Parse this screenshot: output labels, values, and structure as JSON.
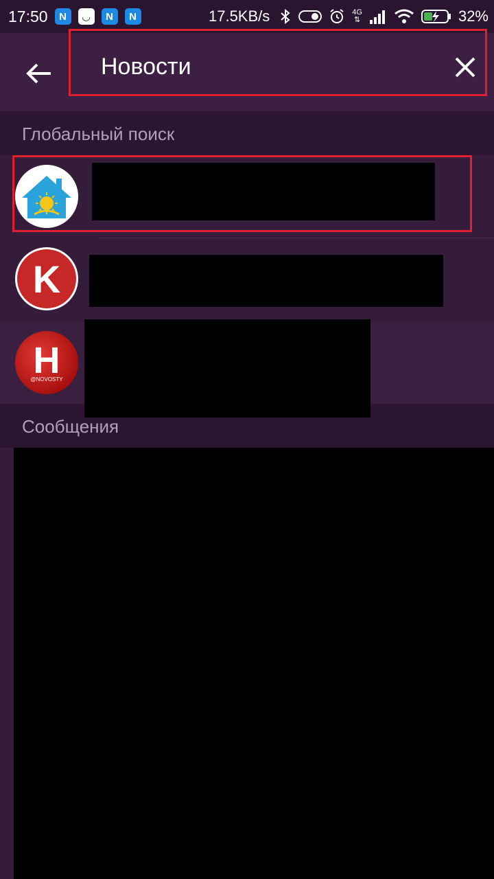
{
  "status_bar": {
    "time": "17:50",
    "apps": [
      "N",
      "◡",
      "N",
      "N"
    ],
    "speed": "17.5KB/s",
    "network": "4G",
    "battery": "32%"
  },
  "search": {
    "value": "Новости",
    "back_icon": "arrow-left-icon",
    "clear_icon": "close-icon"
  },
  "sections": {
    "global": "Глобальный поиск",
    "messages": "Сообщения"
  },
  "results": [
    {
      "avatar": "house-sun-logo",
      "redacted": true
    },
    {
      "avatar": "K",
      "redacted": true
    },
    {
      "avatar": "H",
      "avatar_caption": "@NOVOSTY",
      "redacted": true
    }
  ],
  "colors": {
    "background": "#341c3a",
    "topbar": "#3d1f43",
    "section_header": "#2b1531",
    "highlight": "#e02030"
  }
}
